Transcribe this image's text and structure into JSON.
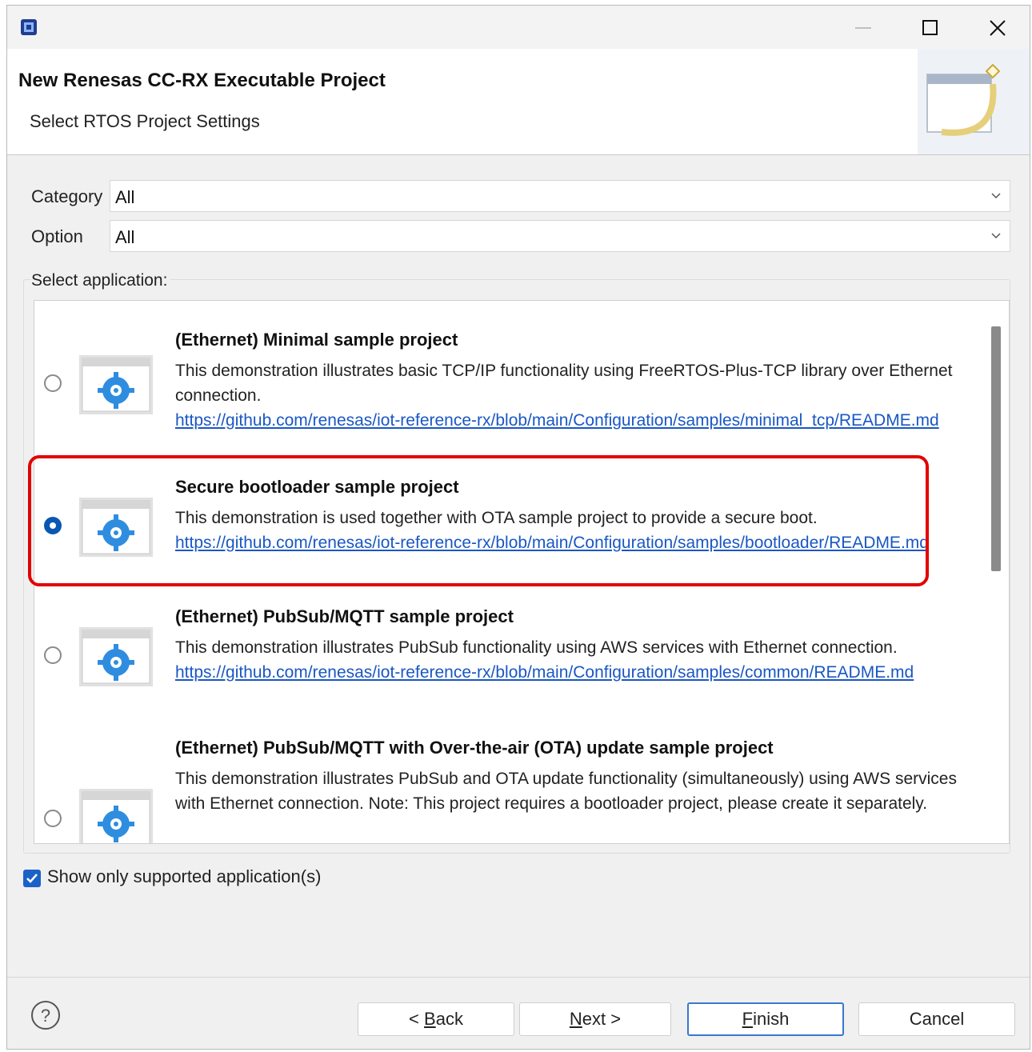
{
  "window": {
    "controls": {
      "minimize": "minimize-icon",
      "maximize": "maximize-icon",
      "close": "close-icon"
    }
  },
  "header": {
    "title": "New Renesas CC-RX Executable Project",
    "subtitle": "Select RTOS Project Settings"
  },
  "filters": {
    "category_label": "Category",
    "category_value": "All",
    "option_label": "Option",
    "option_value": "All"
  },
  "applications": {
    "label": "Select application:",
    "items": [
      {
        "title": "(Ethernet) Minimal sample project",
        "description": "This demonstration illustrates basic TCP/IP functionality using FreeRTOS-Plus-TCP library over Ethernet connection.",
        "link": "https://github.com/renesas/iot-reference-rx/blob/main/Configuration/samples/minimal_tcp/README.md",
        "selected": false
      },
      {
        "title": "Secure bootloader sample project",
        "description": "This demonstration is used together with OTA sample project to provide a secure boot.",
        "link": "https://github.com/renesas/iot-reference-rx/blob/main/Configuration/samples/bootloader/README.md",
        "selected": true
      },
      {
        "title": "(Ethernet) PubSub/MQTT sample project",
        "description": "This demonstration illustrates PubSub functionality using AWS services with Ethernet connection.",
        "link": "https://github.com/renesas/iot-reference-rx/blob/main/Configuration/samples/common/README.md",
        "selected": false
      },
      {
        "title": "(Ethernet) PubSub/MQTT with Over-the-air (OTA) update sample project",
        "description": "This demonstration illustrates PubSub and OTA update functionality (simultaneously) using AWS services with Ethernet connection. Note: This project requires a bootloader project, please create it separately.",
        "link": "",
        "selected": false
      }
    ]
  },
  "show_supported": {
    "label": "Show only supported application(s)",
    "checked": true
  },
  "buttons": {
    "back_prefix": "< ",
    "back_mnemonic": "B",
    "back_rest": "ack",
    "next_mnemonic": "N",
    "next_rest": "ext >",
    "finish_mnemonic": "F",
    "finish_rest": "inish",
    "cancel": "Cancel"
  },
  "colors": {
    "highlight": "#e30000",
    "accent": "#1a62c8",
    "link": "#1957c4"
  }
}
